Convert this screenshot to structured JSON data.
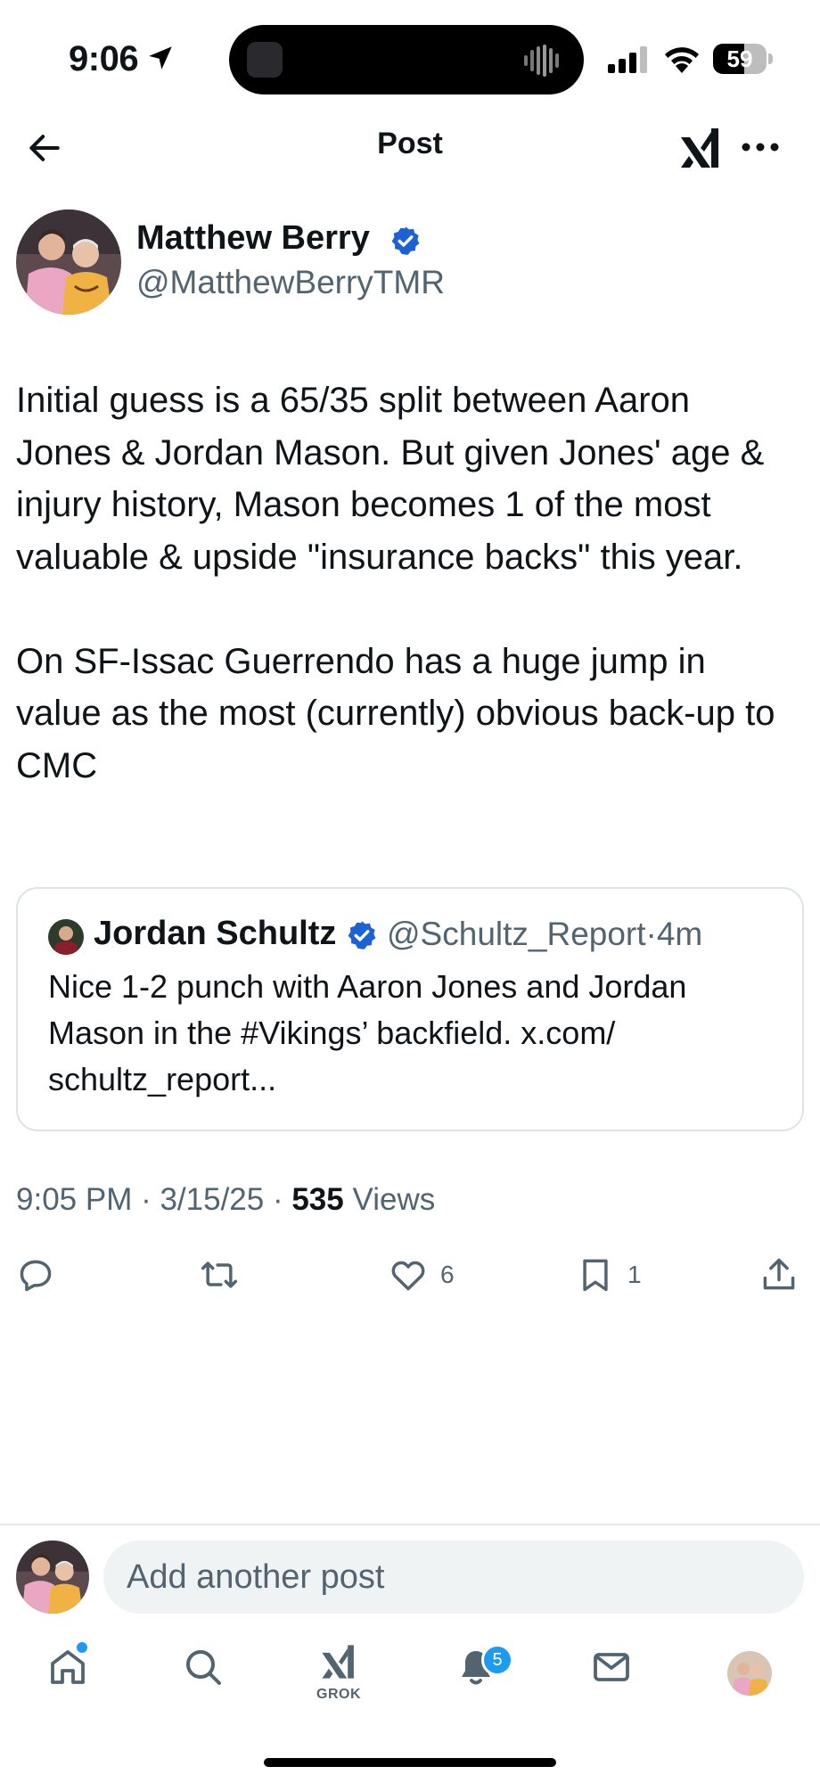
{
  "status_bar": {
    "time": "9:06",
    "battery": "59",
    "battery_level": 0.59
  },
  "header": {
    "title": "Post",
    "back_icon": "arrow-left-icon",
    "grok_icon": "grok-icon",
    "more_icon": "more-horizontal-icon"
  },
  "post": {
    "author": {
      "name": "Matthew Berry",
      "handle": "@MatthewBerryTMR",
      "verified": true
    },
    "text": [
      "Initial guess is a 65/35 split between Aaron Jones & Jordan Mason. But given Jones' age & injury history, Mason becomes 1 of the most valuable & upside \"insurance backs\" this year.",
      "On SF-Issac Guerrendo has a huge jump in value as the most (currently) obvious back-up to CMC"
    ],
    "quote": {
      "name": "Jordan Schultz",
      "handle": "@Schultz_Report",
      "separator": "·",
      "time": "4m",
      "text": "Nice 1-2 punch with Aaron Jones and Jordan Mason in the #Vikings’ backfield. x.com/ schultz_report..."
    },
    "timestamp": "9:05 PM · 3/15/25 ·",
    "views_count": "535",
    "views_label": "Views"
  },
  "actions": {
    "reply": {
      "icon": "reply-icon",
      "count": ""
    },
    "repost": {
      "icon": "repost-icon",
      "count": ""
    },
    "like": {
      "icon": "heart-icon",
      "count": "6"
    },
    "bookmark": {
      "icon": "bookmark-icon",
      "count": "1"
    },
    "share": {
      "icon": "share-icon"
    }
  },
  "compose": {
    "placeholder": "Add another post"
  },
  "tabbar": {
    "items": [
      {
        "name": "home",
        "icon": "home-icon"
      },
      {
        "name": "search",
        "icon": "search-icon"
      },
      {
        "name": "grok",
        "icon": "grok-icon",
        "label": "GROK"
      },
      {
        "name": "notifications",
        "icon": "bell-icon",
        "badge": "5"
      },
      {
        "name": "messages",
        "icon": "mail-icon"
      },
      {
        "name": "profile",
        "icon": "avatar"
      }
    ]
  },
  "colors": {
    "text_primary": "#0f1419",
    "text_secondary": "#536471",
    "accent": "#1d9bf0",
    "verified": "#1d62d3",
    "border": "#dfe3e7"
  }
}
